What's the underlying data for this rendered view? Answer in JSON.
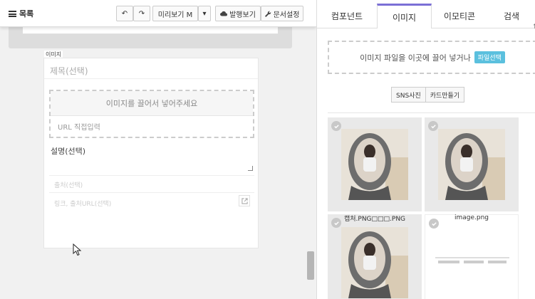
{
  "toolbar": {
    "menu_label": "목록",
    "undo_label": "↶",
    "redo_label": "↷",
    "preview_label": "미리보기 M",
    "preview_dropdown": "▾",
    "publish_label": "발행보기",
    "settings_label": "문서설정"
  },
  "image_block": {
    "tag": "이미지",
    "title_placeholder": "제목(선택)",
    "drop_text": "이미지를 끌어서 넣어주세요",
    "url_placeholder": "URL 직접입력",
    "desc_label": "설명(선택)",
    "source_placeholder": "출처(선택)",
    "link_placeholder": "링크, 출처URL(선택)"
  },
  "panel": {
    "tabs": [
      {
        "label": "컴포넌트",
        "active": false
      },
      {
        "label": "이미지",
        "active": true
      },
      {
        "label": "이모티콘",
        "active": false
      },
      {
        "label": "검색",
        "active": false
      }
    ],
    "upload_text": "이미지 파일을 이곳에 끌어 넣거나",
    "upload_button": "파일선택",
    "group_buttons": [
      "SNS사진",
      "카드만들기"
    ],
    "thumbnails": [
      {
        "name": "",
        "type": "photo"
      },
      {
        "name": "",
        "type": "photo"
      },
      {
        "name": "캡처.PNG□□□.PNG",
        "type": "photo"
      },
      {
        "name": "image.png",
        "type": "screenshot"
      }
    ]
  },
  "colors": {
    "accent": "#7b6fd6",
    "file_button": "#5bc0de"
  }
}
